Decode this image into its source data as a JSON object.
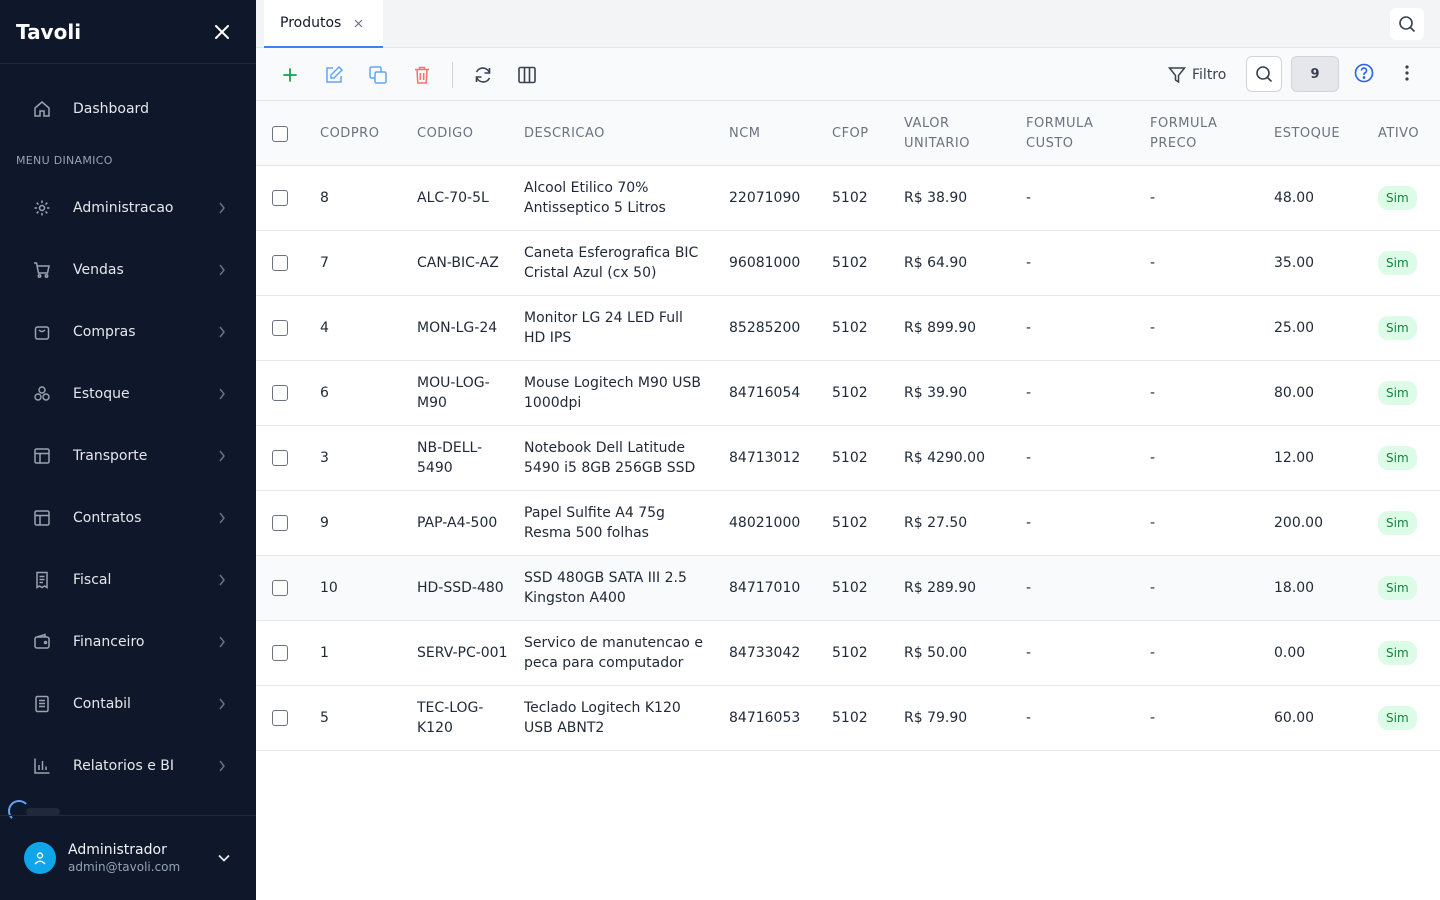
{
  "app": {
    "name": "Tavoli"
  },
  "sidebar": {
    "dashboard_label": "Dashboard",
    "menu_header": "MENU DINAMICO",
    "items": [
      {
        "label": "Administracao",
        "icon": "gear-icon"
      },
      {
        "label": "Vendas",
        "icon": "cart-icon"
      },
      {
        "label": "Compras",
        "icon": "shopping-bag-icon"
      },
      {
        "label": "Estoque",
        "icon": "boxes-icon"
      },
      {
        "label": "Transporte",
        "icon": "layout-icon"
      },
      {
        "label": "Contratos",
        "icon": "layout-icon"
      },
      {
        "label": "Fiscal",
        "icon": "receipt-icon"
      },
      {
        "label": "Financeiro",
        "icon": "wallet-icon"
      },
      {
        "label": "Contabil",
        "icon": "book-icon"
      },
      {
        "label": "Relatorios e BI",
        "icon": "bar-chart-icon"
      }
    ],
    "user": {
      "name": "Administrador",
      "email": "admin@tavoli.com"
    }
  },
  "tabs": [
    {
      "label": "Produtos",
      "active": true
    }
  ],
  "toolbar": {
    "filter_label": "Filtro",
    "record_count": "9"
  },
  "colors": {
    "sidebar_bg": "#0f172a",
    "accent": "#3b82f6",
    "add": "#16a34a",
    "delete": "#ef4444",
    "active_badge_bg": "#dcfce7",
    "active_badge_fg": "#15803d"
  },
  "table": {
    "columns": [
      {
        "key": "codpro",
        "label": "CODPRO"
      },
      {
        "key": "codigo",
        "label": "CODIGO"
      },
      {
        "key": "descricao",
        "label": "DESCRICAO"
      },
      {
        "key": "ncm",
        "label": "NCM"
      },
      {
        "key": "cfop",
        "label": "CFOP"
      },
      {
        "key": "valor_unitario",
        "label": "VALOR UNITARIO"
      },
      {
        "key": "formula_custo",
        "label": "FORMULA CUSTO"
      },
      {
        "key": "formula_preco",
        "label": "FORMULA PRECO"
      },
      {
        "key": "estoque",
        "label": "ESTOQUE"
      },
      {
        "key": "ativo",
        "label": "ATIVO"
      }
    ],
    "rows": [
      {
        "codpro": "8",
        "codigo": "ALC-70-5L",
        "descricao": "Alcool Etilico 70% Antisseptico 5 Litros",
        "ncm": "22071090",
        "cfop": "5102",
        "valor_unitario": "R$ 38.90",
        "formula_custo": "-",
        "formula_preco": "-",
        "estoque": "48.00",
        "ativo": "Sim"
      },
      {
        "codpro": "7",
        "codigo": "CAN-BIC-AZ",
        "descricao": "Caneta Esferografica BIC Cristal Azul (cx 50)",
        "ncm": "96081000",
        "cfop": "5102",
        "valor_unitario": "R$ 64.90",
        "formula_custo": "-",
        "formula_preco": "-",
        "estoque": "35.00",
        "ativo": "Sim"
      },
      {
        "codpro": "4",
        "codigo": "MON-LG-24",
        "descricao": "Monitor LG 24 LED Full HD IPS",
        "ncm": "85285200",
        "cfop": "5102",
        "valor_unitario": "R$ 899.90",
        "formula_custo": "-",
        "formula_preco": "-",
        "estoque": "25.00",
        "ativo": "Sim"
      },
      {
        "codpro": "6",
        "codigo": "MOU-LOG-M90",
        "descricao": "Mouse Logitech M90 USB 1000dpi",
        "ncm": "84716054",
        "cfop": "5102",
        "valor_unitario": "R$ 39.90",
        "formula_custo": "-",
        "formula_preco": "-",
        "estoque": "80.00",
        "ativo": "Sim"
      },
      {
        "codpro": "3",
        "codigo": "NB-DELL-5490",
        "descricao": "Notebook Dell Latitude 5490 i5 8GB 256GB SSD",
        "ncm": "84713012",
        "cfop": "5102",
        "valor_unitario": "R$ 4290.00",
        "formula_custo": "-",
        "formula_preco": "-",
        "estoque": "12.00",
        "ativo": "Sim"
      },
      {
        "codpro": "9",
        "codigo": "PAP-A4-500",
        "descricao": "Papel Sulfite A4 75g Resma 500 folhas",
        "ncm": "48021000",
        "cfop": "5102",
        "valor_unitario": "R$ 27.50",
        "formula_custo": "-",
        "formula_preco": "-",
        "estoque": "200.00",
        "ativo": "Sim"
      },
      {
        "codpro": "10",
        "codigo": "HD-SSD-480",
        "descricao": "SSD 480GB SATA III 2.5 Kingston A400",
        "ncm": "84717010",
        "cfop": "5102",
        "valor_unitario": "R$ 289.90",
        "formula_custo": "-",
        "formula_preco": "-",
        "estoque": "18.00",
        "ativo": "Sim"
      },
      {
        "codpro": "1",
        "codigo": "SERV-PC-001",
        "descricao": "Servico de manutencao e peca para computador",
        "ncm": "84733042",
        "cfop": "5102",
        "valor_unitario": "R$ 50.00",
        "formula_custo": "-",
        "formula_preco": "-",
        "estoque": "0.00",
        "ativo": "Sim"
      },
      {
        "codpro": "5",
        "codigo": "TEC-LOG-K120",
        "descricao": "Teclado Logitech K120 USB ABNT2",
        "ncm": "84716053",
        "cfop": "5102",
        "valor_unitario": "R$ 79.90",
        "formula_custo": "-",
        "formula_preco": "-",
        "estoque": "60.00",
        "ativo": "Sim"
      }
    ]
  }
}
